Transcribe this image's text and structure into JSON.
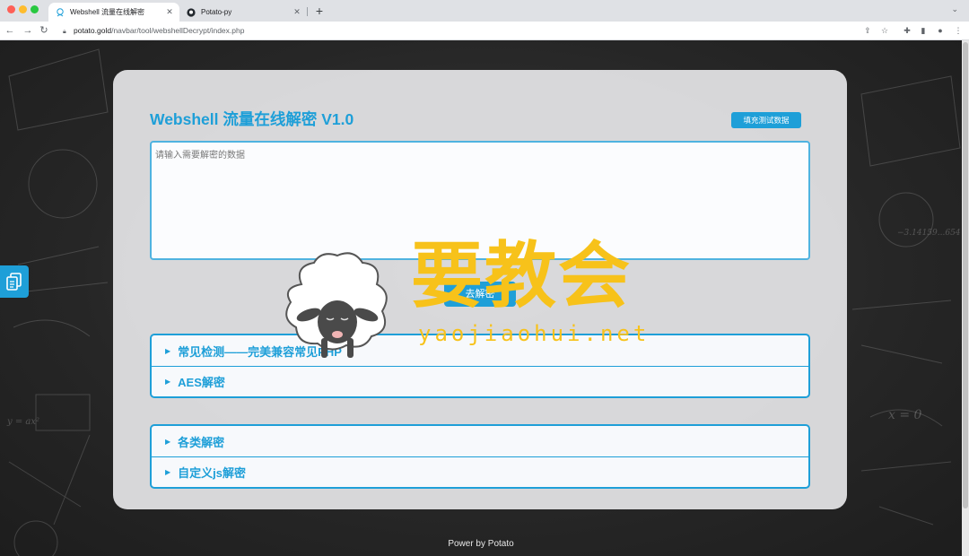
{
  "browser": {
    "tabs": [
      {
        "title": "Webshell 流量在线解密",
        "active": true
      },
      {
        "title": "Potato-py",
        "active": false
      }
    ],
    "address": {
      "domain": "potato.gold",
      "path": "/navbar/tool/webshellDecrypt/index.php"
    }
  },
  "page": {
    "title": "Webshell 流量在线解密 V1.0",
    "fill_button": "填充测试数据",
    "input_placeholder": "请输入需要解密的数据",
    "decrypt_button": "去解密",
    "groups": [
      {
        "items": [
          "常见检测——完美兼容常见PHP",
          "AES解密"
        ]
      },
      {
        "items": [
          "各类解密",
          "自定义js解密"
        ]
      }
    ],
    "footer": "Power by Potato"
  },
  "watermark": {
    "text": "要教会",
    "url": "yaojiaohui.net"
  },
  "colors": {
    "accent": "#1e9fd8",
    "watermark": "#f7c21a",
    "card": "#e5e5e7"
  }
}
